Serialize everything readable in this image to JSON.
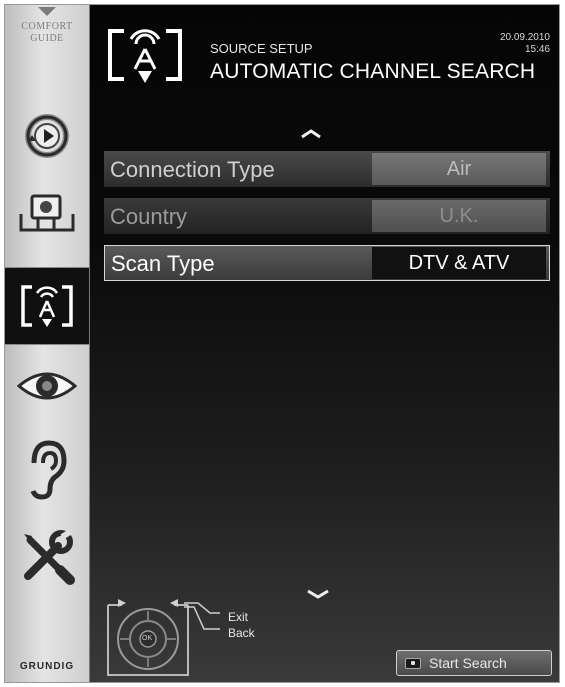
{
  "sidebar": {
    "comfort_guide": "COMFORT\nGUIDE",
    "brand": "GRUNDIG",
    "items": [
      {
        "icon": "playback-icon",
        "active": false
      },
      {
        "icon": "network-media-icon",
        "active": false
      },
      {
        "icon": "antenna-source-icon",
        "active": true
      },
      {
        "icon": "picture-eye-icon",
        "active": false
      },
      {
        "icon": "sound-ear-icon",
        "active": false
      },
      {
        "icon": "tools-icon",
        "active": false
      }
    ]
  },
  "header": {
    "subtitle": "SOURCE SETUP",
    "title": "AUTOMATIC CHANNEL SEARCH",
    "date": "20.09.2010",
    "time": "15:46"
  },
  "menu": {
    "rows": [
      {
        "label": "Connection Type",
        "value": "Air",
        "state": "dim"
      },
      {
        "label": "Country",
        "value": "U.K.",
        "state": "disabled"
      },
      {
        "label": "Scan Type",
        "value": "DTV & ATV",
        "state": "selected"
      }
    ]
  },
  "footer": {
    "exit_label": "Exit",
    "back_label": "Back",
    "ok_label": "OK",
    "start_search_label": "Start Search"
  },
  "colors": {
    "background": "#0d0d0d",
    "sidebar": "#d6d6d6",
    "selected_value": "#111111"
  }
}
